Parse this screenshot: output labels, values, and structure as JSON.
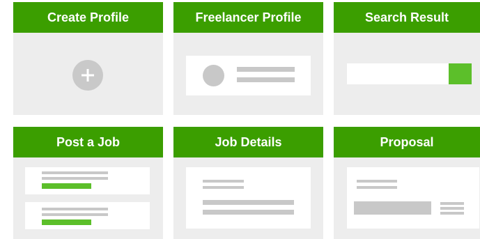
{
  "cards": [
    {
      "title": "Create Profile"
    },
    {
      "title": "Freelancer Profile"
    },
    {
      "title": "Search Result"
    },
    {
      "title": "Post a Job"
    },
    {
      "title": "Job Details"
    },
    {
      "title": "Proposal"
    }
  ],
  "colors": {
    "header_green": "#3b9e00",
    "accent_green": "#5cbf2a",
    "card_gray": "#ededed",
    "placeholder_gray": "#c8c8c8"
  },
  "icons": {
    "create_profile": "plus-icon",
    "freelancer_avatar": "avatar-placeholder-icon"
  }
}
